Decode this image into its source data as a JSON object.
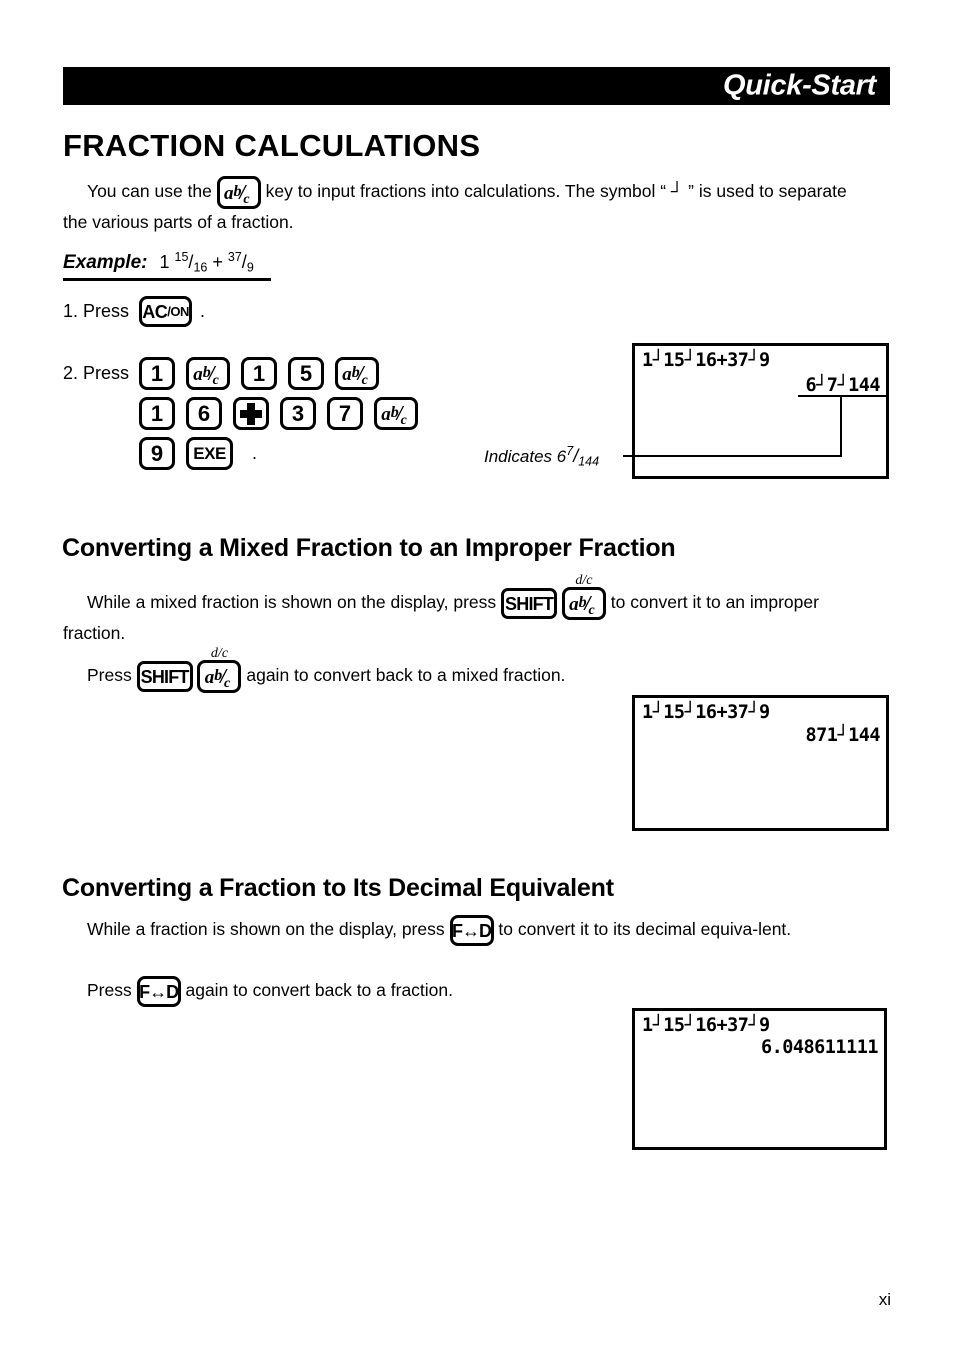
{
  "header": {
    "title": "Quick-Start"
  },
  "section_title": "FRACTION CALCULATIONS",
  "intro": {
    "before_key": "You can use the",
    "after_key": "key to input fractions into calculations. The symbol “ ┘ ” is used to separate the various parts of a fraction."
  },
  "example": {
    "label": "Example:",
    "whole": "1",
    "frac1_num": "15",
    "frac1_den": "16",
    "operator": "+",
    "frac2_num": "37",
    "frac2_den": "9",
    "slash": "/"
  },
  "steps": [
    {
      "number": "1. Press",
      "period": "."
    },
    {
      "number": "2. Press",
      "period": "."
    }
  ],
  "keys": {
    "abc": {
      "a": "a",
      "b": "b",
      "slash": "/",
      "c": "c",
      "name": "a-b-c-fraction-key"
    },
    "acon_ac": "AC",
    "acon_on": "/ON",
    "exe": "EXE",
    "shift": "SHIFT",
    "fd": "F↔D",
    "dc_label": "d/c",
    "plus": "+",
    "one": "1",
    "five": "5",
    "six": "6",
    "three": "3",
    "seven": "7",
    "nine": "9"
  },
  "keypad": {
    "row1": [
      "1",
      "abc",
      "1",
      "5",
      "abc"
    ],
    "row2": [
      "1",
      "6",
      "plus",
      "3",
      "7",
      "abc"
    ],
    "row3": [
      "9",
      "EXE"
    ]
  },
  "displays": {
    "first": {
      "entry": "1┘15┘16+37┘9",
      "result": "6┘7┘144"
    },
    "second": {
      "entry": "1┘15┘16+37┘9",
      "result": "871┘144"
    },
    "third": {
      "entry": "1┘15┘16+37┘9",
      "result": "6.048611111"
    }
  },
  "callout": {
    "text_prefix": "Indicates 6",
    "num": "7",
    "slash": "/",
    "den": "144"
  },
  "improper": {
    "heading": "Converting a Mixed Fraction to an Improper Fraction",
    "line1_before": "While a mixed fraction is shown on the display, press",
    "line1_after": "to convert it to an improper fraction.",
    "line2_before": "Press",
    "line2_after": "again to convert back to a mixed fraction."
  },
  "decimal": {
    "heading": "Converting a Fraction to Its Decimal Equivalent",
    "line1_before": "While a fraction is shown on the display, press",
    "line1_after": "to convert it to its decimal equiva-lent.",
    "line2_before": "Press",
    "line2_after": "again to convert back to a fraction."
  },
  "page_number": "xi"
}
